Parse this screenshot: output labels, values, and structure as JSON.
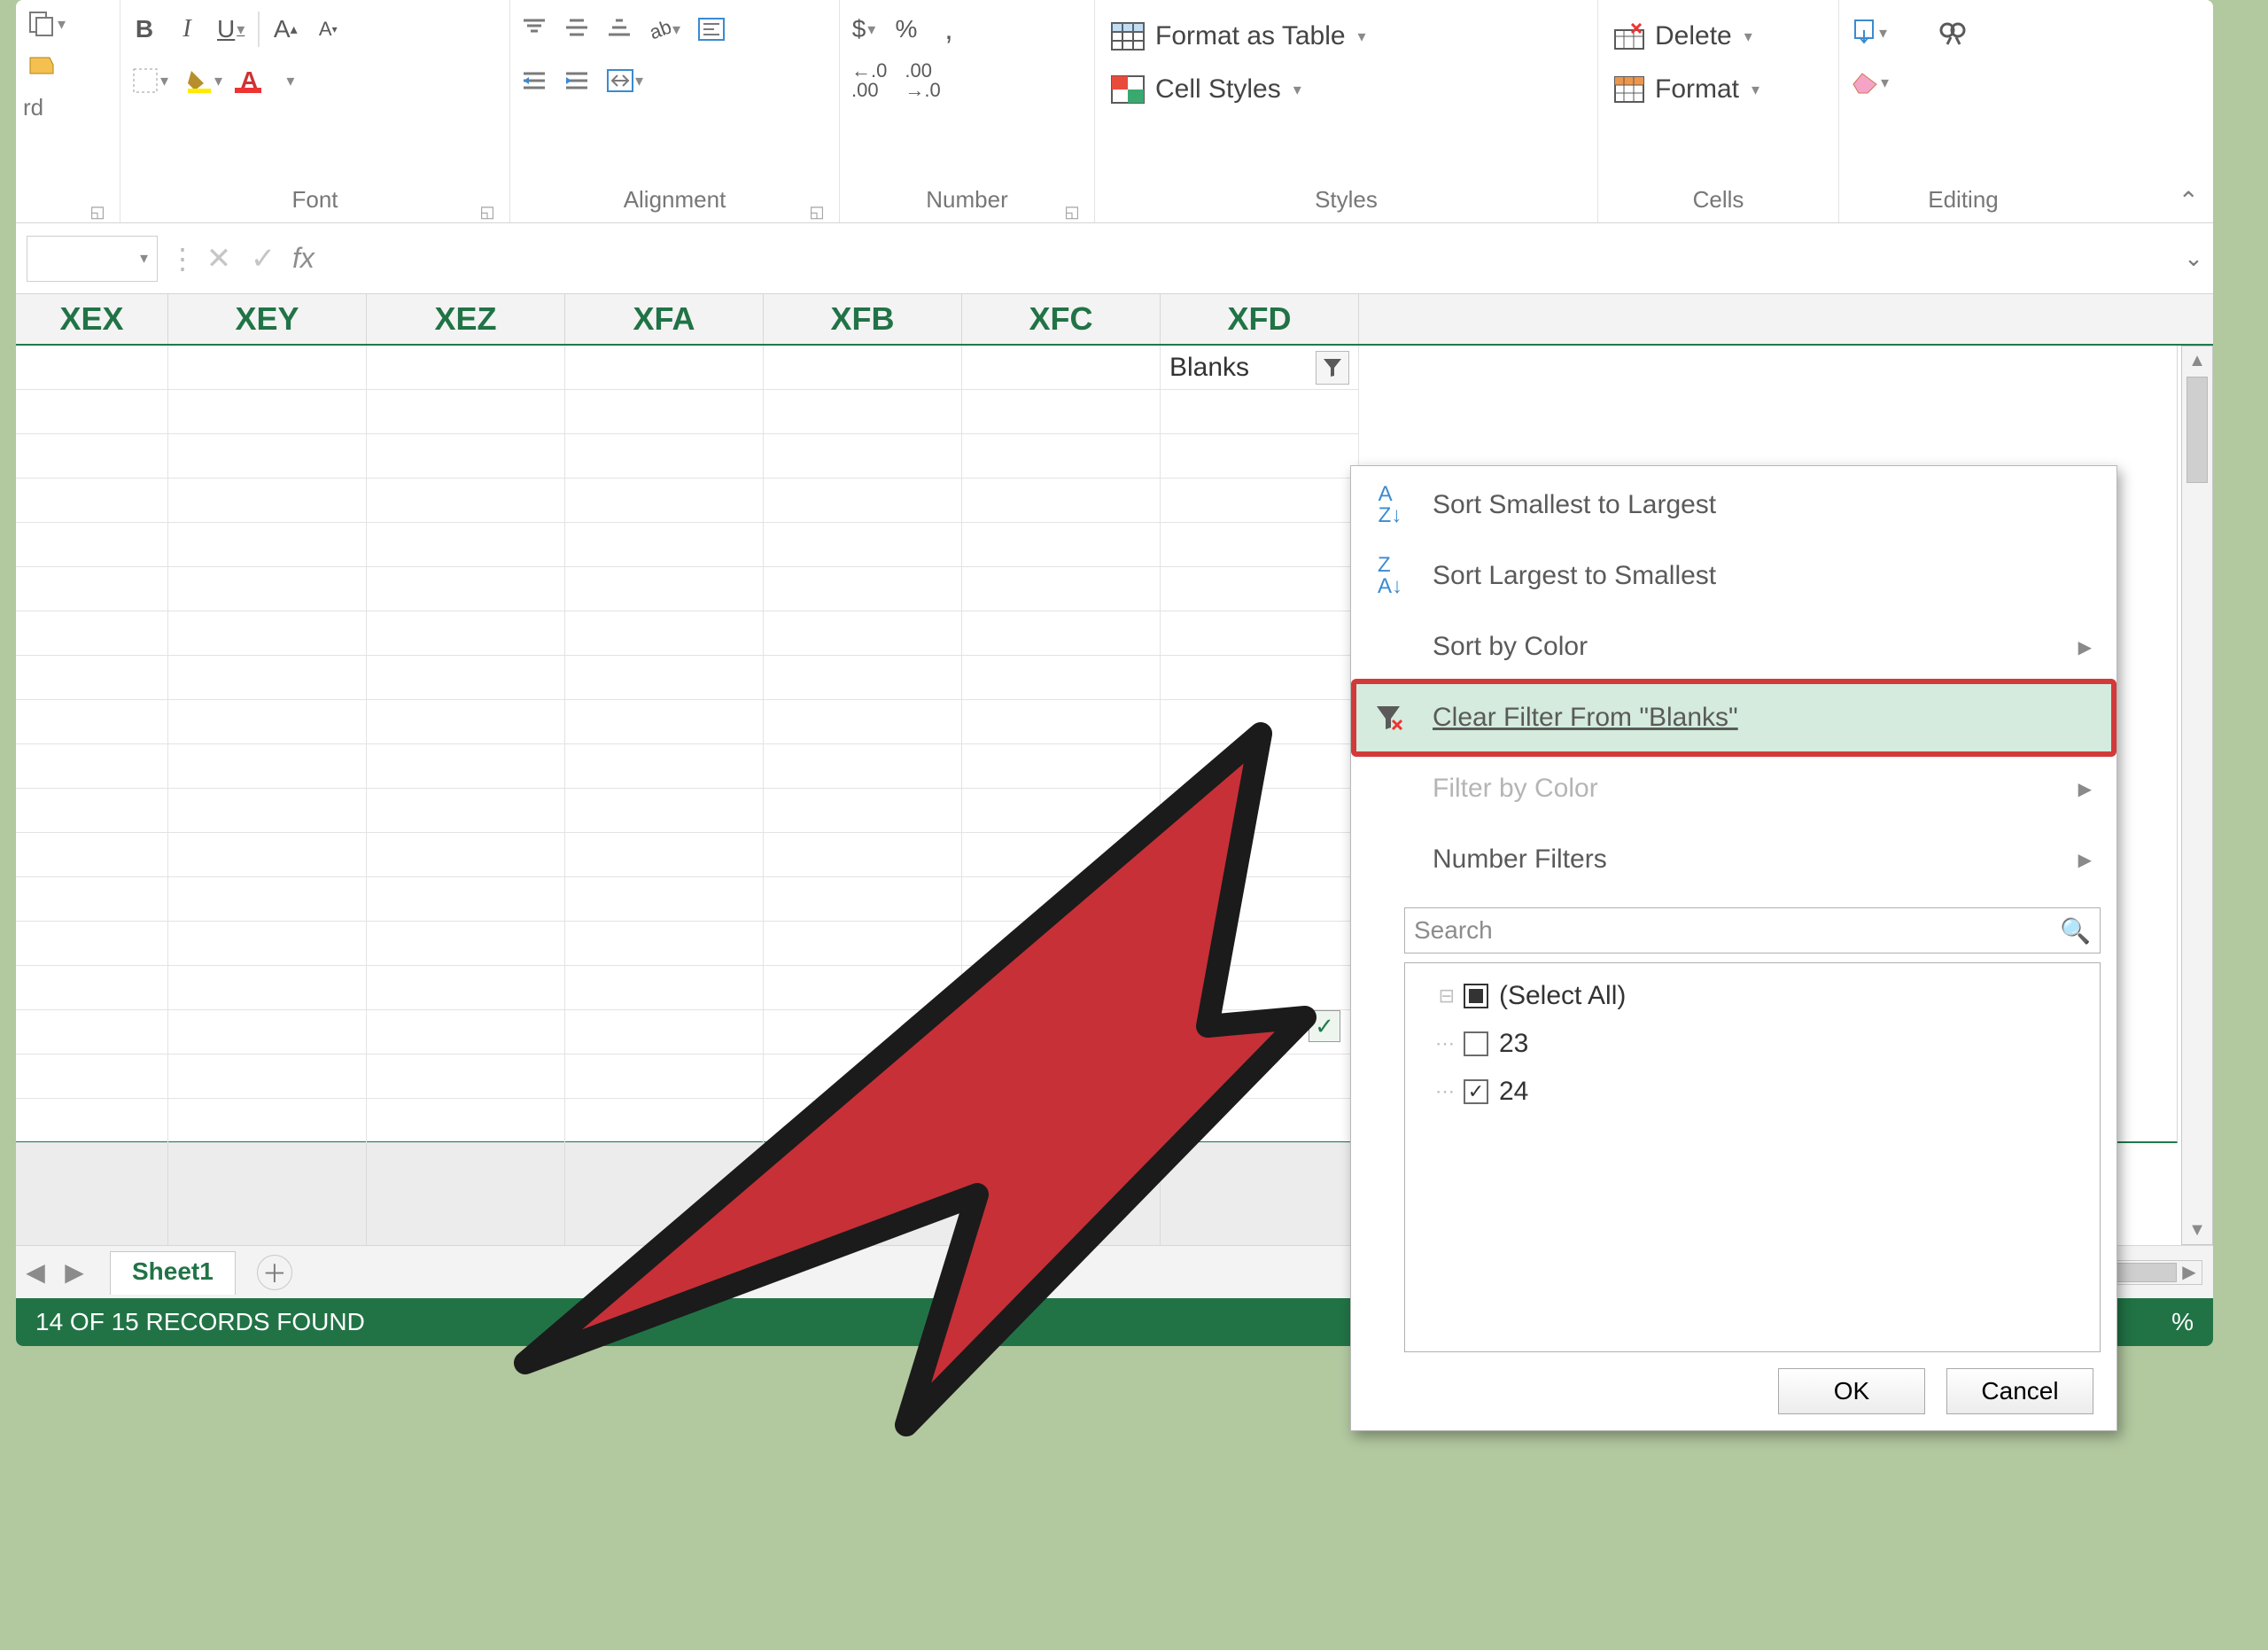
{
  "ribbon": {
    "groups": {
      "clipboard": {
        "label": "",
        "last_visible": "rd"
      },
      "font": {
        "label": "Font"
      },
      "alignment": {
        "label": "Alignment"
      },
      "number": {
        "label": "Number"
      },
      "styles": {
        "label": "Styles",
        "format_as_table": "Format as Table",
        "cell_styles": "Cell Styles"
      },
      "cells": {
        "label": "Cells",
        "delete": "Delete",
        "format": "Format"
      },
      "editing": {
        "label": "Editing"
      }
    },
    "currency": "$",
    "percent": "%",
    "inc_dec": [
      ".0",
      ".00"
    ]
  },
  "formula_bar": {
    "fx": "fx",
    "value": ""
  },
  "column_headers": [
    "XEX",
    "XEY",
    "XEZ",
    "XFA",
    "XFB",
    "XFC",
    "XFD"
  ],
  "grid": {
    "first_row_last_cell": "Blanks"
  },
  "filter_menu": {
    "sort_asc": "Sort Smallest to Largest",
    "sort_desc": "Sort Largest to Smallest",
    "sort_color": "Sort by Color",
    "clear_filter": "Clear Filter From \"Blanks\"",
    "filter_color": "Filter by Color",
    "number_filters": "Number Filters",
    "search_placeholder": "Search",
    "checklist": {
      "select_all": "(Select All)",
      "items": [
        {
          "label": "23",
          "checked": false
        },
        {
          "label": "24",
          "checked": true
        }
      ]
    },
    "ok": "OK",
    "cancel": "Cancel"
  },
  "sheet_tabs": {
    "active": "Sheet1"
  },
  "status_bar": {
    "left": "14 OF 15 RECORDS FOUND",
    "right": "%"
  }
}
